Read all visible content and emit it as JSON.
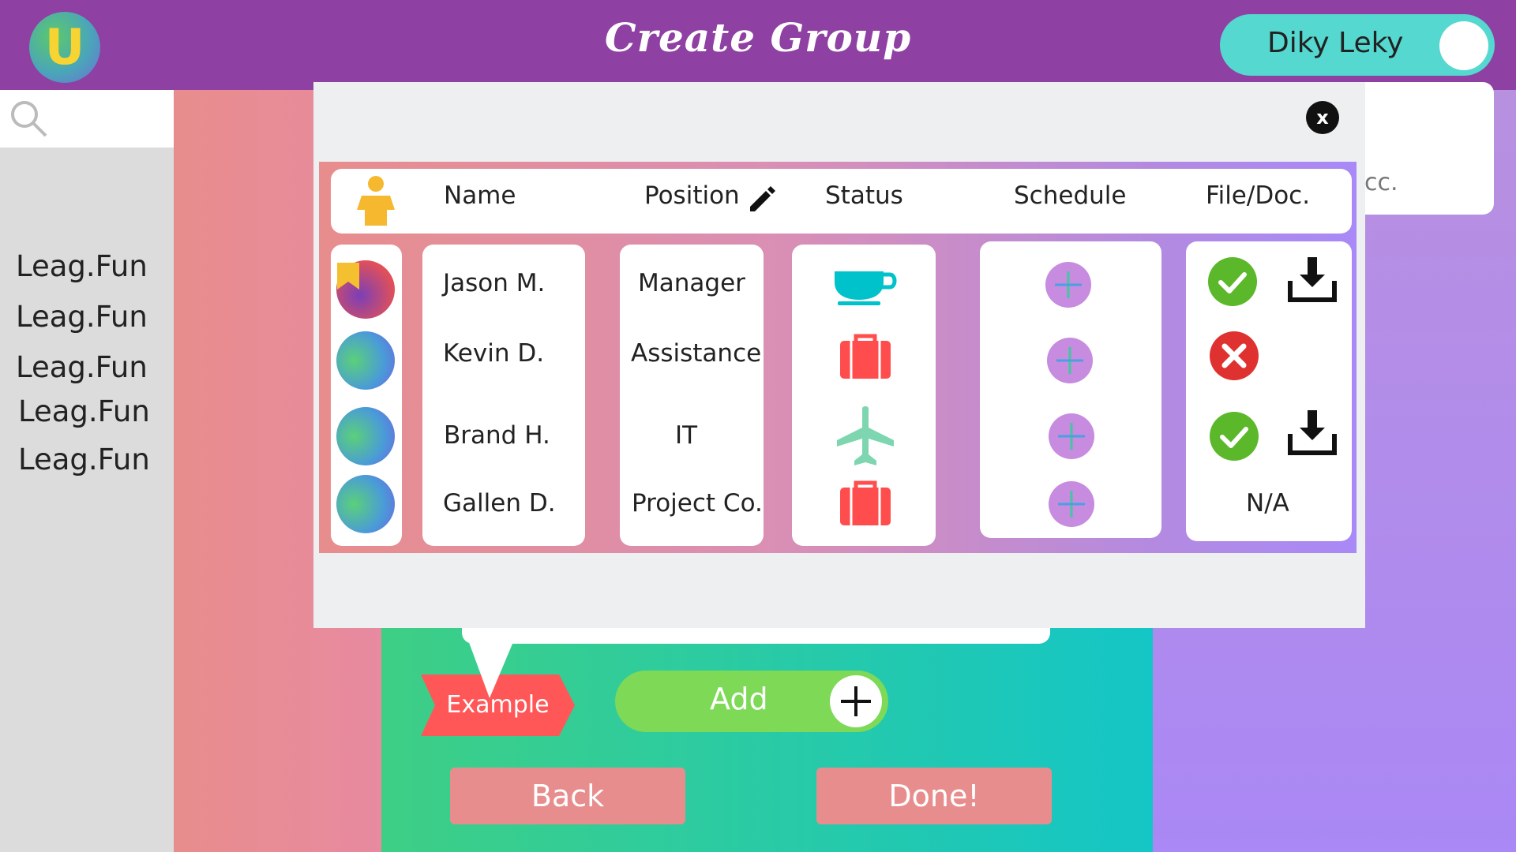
{
  "header": {
    "logo_letter": "U",
    "title": "Create Group",
    "user_name": "Diky Leky"
  },
  "sidebar": {
    "search_icon": "search-icon",
    "items": [
      "Leag.Fun",
      "Leag.Fun",
      "Leag.Fun",
      "Leag.Fun",
      "Leag.Fun"
    ]
  },
  "background_card": {
    "text": "cc."
  },
  "modal": {
    "close_label": "x",
    "columns": {
      "name": "Name",
      "position": "Position",
      "status": "Status",
      "schedule": "Schedule",
      "file_doc": "File/Doc."
    },
    "rows": [
      {
        "name": "Jason M.",
        "position": "Manager",
        "status_icon": "coffee-cup-icon",
        "file": "check-icon",
        "download": true
      },
      {
        "name": "Kevin D.",
        "position": "Assistance",
        "status_icon": "briefcase-icon",
        "file": "x-circle-icon",
        "download": false
      },
      {
        "name": "Brand H.",
        "position": "IT",
        "status_icon": "airplane-icon",
        "file": "check-icon",
        "download": true
      },
      {
        "name": "Gallen D.",
        "position": "Project Co.",
        "status_icon": "briefcase-icon",
        "file_text": "N/A",
        "download": false
      }
    ]
  },
  "form": {
    "example_label": "Example",
    "add_label": "Add",
    "back_label": "Back",
    "done_label": "Done!"
  },
  "colors": {
    "topbar": "#8f40a3",
    "toggle": "#55d8cf",
    "add_green": "#7ed957",
    "button_pink": "#e88d8d",
    "example_red": "#ff5757",
    "coffee_teal": "#00c2cb",
    "briefcase_red": "#ff4d4d",
    "airplane_mint": "#7ed6b0",
    "check_green": "#5cb82b",
    "x_red": "#e03131",
    "schedule_purple": "#c78be0"
  }
}
